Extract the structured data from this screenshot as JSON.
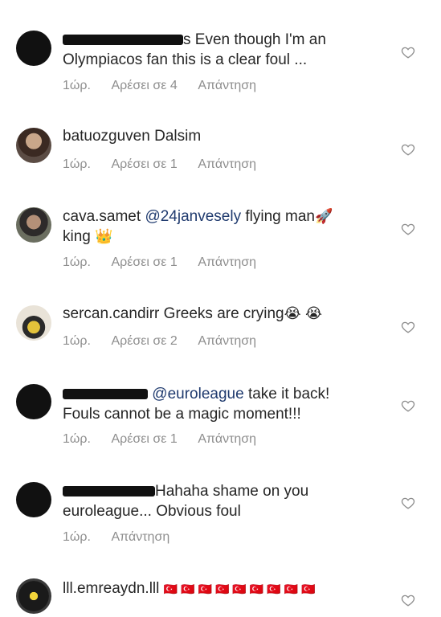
{
  "comments": [
    {
      "username": "",
      "text": "s Even though I'm an Olympiacos fan this is a clear foul ...",
      "time": "1ώρ.",
      "likes": "Αρέσει σε 4",
      "reply": "Απάντηση"
    },
    {
      "username": "batuozguven",
      "text": "Dalsim",
      "time": "1ώρ.",
      "likes": "Αρέσει σε 1",
      "reply": "Απάντηση"
    },
    {
      "username": "cava.samet",
      "mention": "@24janvesely",
      "text": "flying man",
      "text2": "king",
      "emoji1": "🚀",
      "emoji2": "👑",
      "time": "1ώρ.",
      "likes": "Αρέσει σε 1",
      "reply": "Απάντηση"
    },
    {
      "username": "sercan.candirr",
      "text": "Greeks are crying",
      "emoji1": "😭",
      "emoji2": "😭",
      "time": "1ώρ.",
      "likes": "Αρέσει σε 2",
      "reply": "Απάντηση"
    },
    {
      "username": "",
      "mention": "@euroleague",
      "text": "take it back!",
      "text2": "Fouls cannot be a magic moment!!!",
      "time": "1ώρ.",
      "likes": "Αρέσει σε 1",
      "reply": "Απάντηση"
    },
    {
      "username": "",
      "text": "Hahaha shame on you",
      "text2": "euroleague... Obvious foul",
      "time": "1ώρ.",
      "reply": "Απάντηση"
    },
    {
      "username": "lll.emreaydn.lll",
      "flags": "🇹🇷🇹🇷🇹🇷🇹🇷🇹🇷🇹🇷🇹🇷🇹🇷🇹🇷"
    }
  ],
  "colors": {
    "meta": "#8e8e8e",
    "mention": "#1f3a6e",
    "text": "#262626"
  }
}
